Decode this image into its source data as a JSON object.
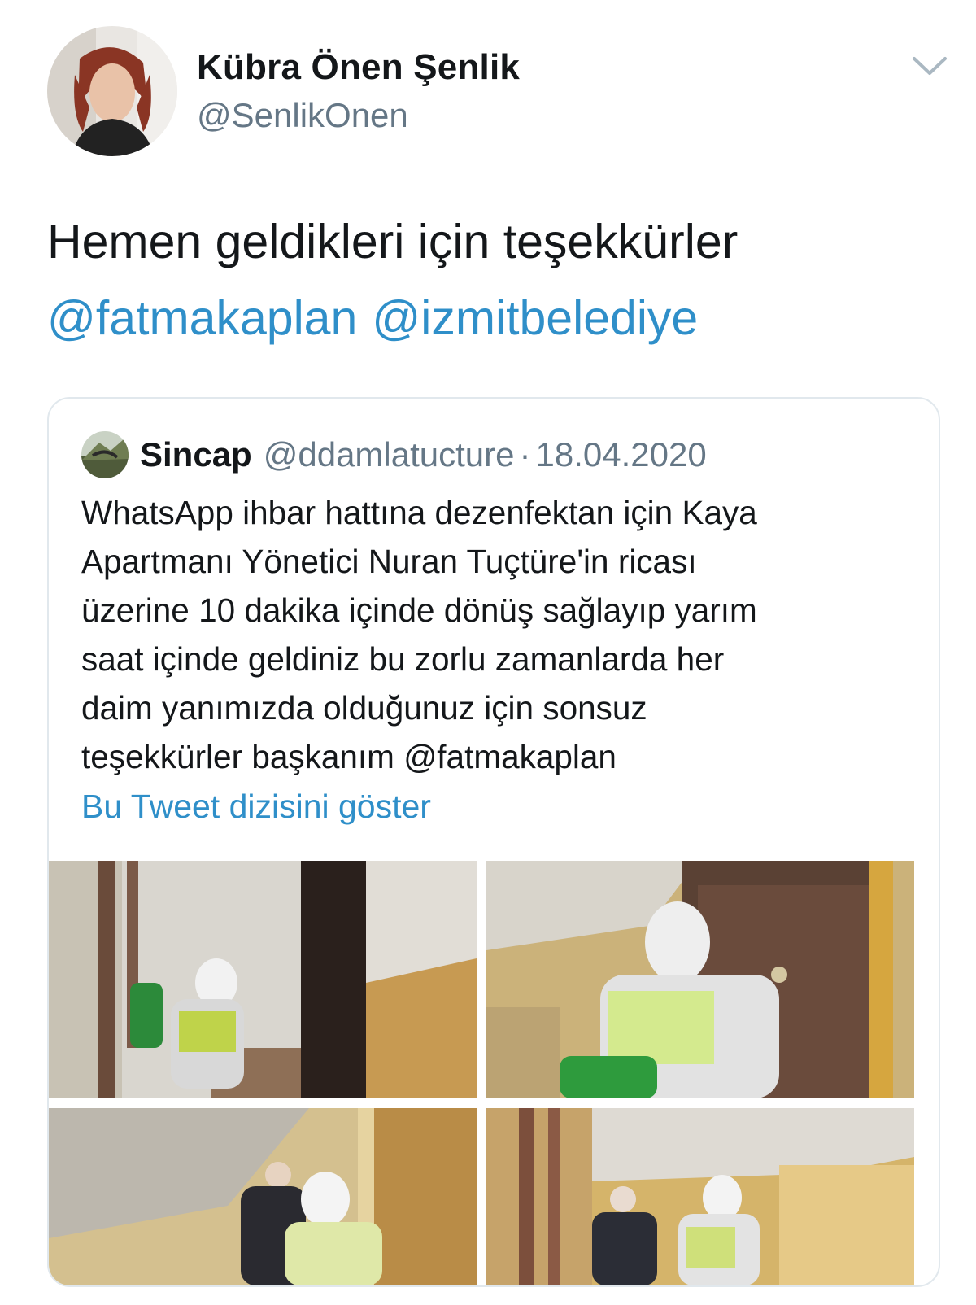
{
  "tweet": {
    "author": {
      "name": "Kübra Önen Şenlik",
      "handle": "@SenlikOnen"
    },
    "menu_icon": "chevron-down-icon",
    "text": "Hemen geldikleri için teşekkürler",
    "mentions": [
      "@fatmakaplan",
      "@izmitbelediye"
    ]
  },
  "quoted_tweet": {
    "author": {
      "name": "Sincap",
      "handle": "@ddamlatucture"
    },
    "separator": "·",
    "date": "18.04.2020",
    "text_lines": [
      "WhatsApp ihbar hattına dezenfektan için Kaya",
      "Apartmanı Yönetici Nuran Tuçtüre'in ricası",
      "üzerine 10 dakika içinde dönüş sağlayıp yarım",
      "saat içinde geldiniz bu zorlu zamanlarda her",
      "daim yanımızda olduğunuz için sonsuz",
      "teşekkürler başkanım"
    ],
    "text_mention": "@fatmakaplan",
    "show_thread": "Bu Tweet dizisini göster"
  },
  "colors": {
    "link": "#2f8fc9",
    "secondary_text": "#657786",
    "border": "#e1e8ed"
  }
}
